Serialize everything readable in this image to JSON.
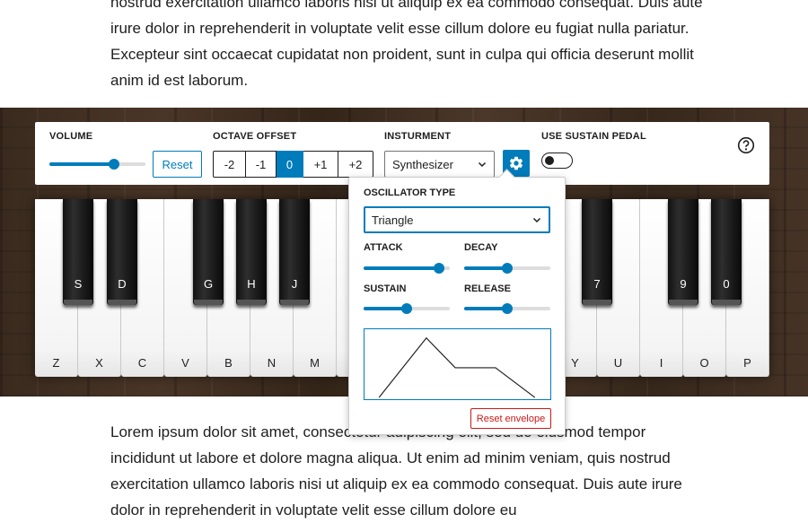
{
  "paragraphs": {
    "top": "nostrud exercitation ullamco laboris nisi ut aliquip ex ea commodo consequat. Duis aute irure dolor in reprehenderit in voluptate velit esse cillum dolore eu fugiat nulla pariatur. Excepteur sint occaecat cupidatat non proident, sunt in culpa qui officia deserunt mollit anim id est laborum.",
    "bottom": "Lorem ipsum dolor sit amet, consectetur adipiscing elit, sed do eiusmod tempor incididunt ut labore et dolore magna aliqua. Ut enim ad minim veniam, quis nostrud exercitation ullamco laboris nisi ut aliquip ex ea commodo consequat. Duis aute irure dolor in reprehenderit in voluptate velit esse cillum dolore eu"
  },
  "toolbar": {
    "volume_label": "VOLUME",
    "volume_value": 0.67,
    "reset_label": "Reset",
    "octave_label": "OCTAVE OFFSET",
    "octave_options": [
      "-2",
      "-1",
      "0",
      "+1",
      "+2"
    ],
    "octave_selected": "0",
    "instrument_label": "INSTURMENT",
    "instrument_value": "Synthesizer",
    "sustain_label": "USE SUSTAIN PEDAL",
    "sustain_on": false
  },
  "keyboard": {
    "white_keys": [
      "Z",
      "X",
      "C",
      "V",
      "B",
      "N",
      "M",
      "",
      "",
      "",
      "",
      "",
      "Y",
      "U",
      "I",
      "O",
      "P"
    ],
    "black_keys": [
      "S",
      "D",
      "G",
      "H",
      "J",
      "7",
      "9",
      "0"
    ]
  },
  "synth_panel": {
    "oscillator_label": "OSCILLATOR TYPE",
    "oscillator_value": "Triangle",
    "attack_label": "ATTACK",
    "attack_value": 0.88,
    "decay_label": "DECAY",
    "decay_value": 0.5,
    "sustain_label": "SUSTAIN",
    "sustain_value": 0.5,
    "release_label": "RELEASE",
    "release_value": 0.5,
    "reset_envelope_label": "Reset envelope"
  },
  "colors": {
    "accent": "#007cba",
    "danger": "#cc1818",
    "wood": "#3f2e22"
  }
}
